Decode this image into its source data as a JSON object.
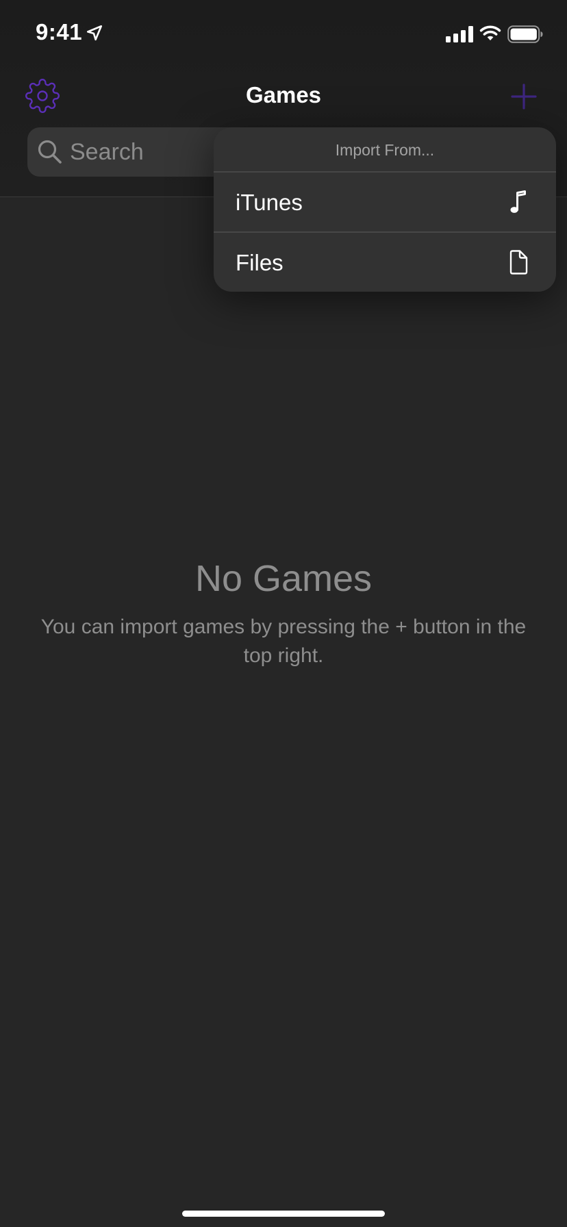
{
  "status_bar": {
    "time": "9:41",
    "icons": [
      "location-arrow-icon",
      "cellular-signal-icon",
      "wifi-icon",
      "battery-icon"
    ]
  },
  "nav_bar": {
    "title": "Games",
    "left_icon": "gear-icon",
    "right_icon": "plus-icon"
  },
  "search": {
    "placeholder": "Search",
    "icon": "magnifying-glass-icon"
  },
  "import_menu": {
    "header": "Import From...",
    "items": [
      {
        "label": "iTunes",
        "icon": "music-note-icon"
      },
      {
        "label": "Files",
        "icon": "document-icon"
      }
    ]
  },
  "empty_state": {
    "title": "No Games",
    "message": "You can import games by pressing the + button in the top right."
  },
  "colors": {
    "accent": "#5b2fb8",
    "background": "#262626",
    "menu_background": "#323232",
    "secondary_text": "#8e8e8e"
  }
}
